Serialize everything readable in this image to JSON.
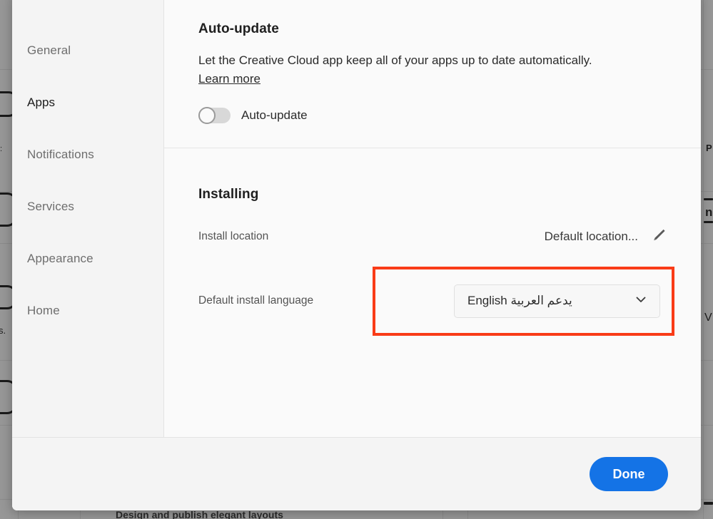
{
  "dialog": {
    "sidebar": {
      "items": [
        {
          "label": "General",
          "selected": false
        },
        {
          "label": "Apps",
          "selected": true
        },
        {
          "label": "Notifications",
          "selected": false
        },
        {
          "label": "Services",
          "selected": false
        },
        {
          "label": "Appearance",
          "selected": false
        },
        {
          "label": "Home",
          "selected": false
        }
      ]
    },
    "auto_update": {
      "title": "Auto-update",
      "description": "Let the Creative Cloud app keep all of your apps up to date automatically.",
      "learn_more": "Learn more",
      "toggle_label": "Auto-update",
      "toggle_state": "off"
    },
    "installing": {
      "title": "Installing",
      "install_location_label": "Install location",
      "install_location_value": "Default location...",
      "edit_icon": "pencil-icon",
      "language_label": "Default install language",
      "language_value": "English يدعم العربية",
      "dropdown_icon": "chevron-down-icon",
      "highlight_color": "#f93b17"
    },
    "footer": {
      "done_label": "Done",
      "done_color": "#1473e6"
    }
  },
  "backdrop": {
    "overlay_color": "#979797",
    "bottom_text_left": "Design and publish elegant layouts",
    "partial_text_left": "s.",
    "partial_text_right_top": "P",
    "partial_text_right_mid": "n"
  }
}
